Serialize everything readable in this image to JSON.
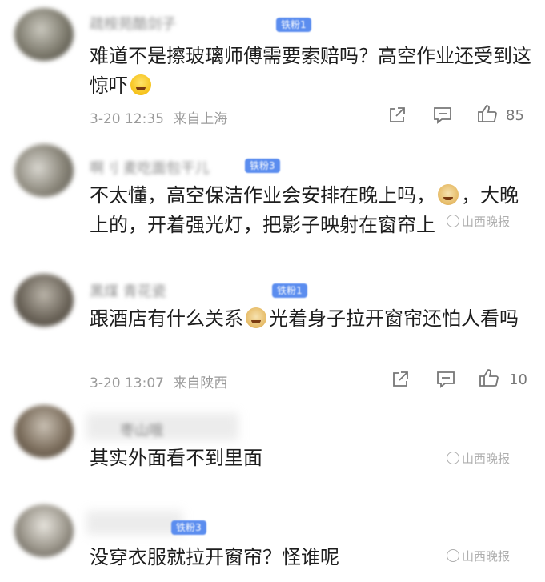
{
  "comments": [
    {
      "name": "疏桉苑酷剑子",
      "badge": "铁粉1",
      "text": "难道不是擦玻璃师傅需要索赔吗？高空作业还受到这惊吓",
      "time": "3-20 12:35",
      "location": "来自上海",
      "likes": "85",
      "emoji": "laughing-crying-emoji"
    },
    {
      "name": "啊刂 麦吃面包干儿",
      "badge": "铁粉3",
      "text_part1": "不太懂，高空保洁作业会安排在晚上吗，",
      "text_part2": "，大晚上的，开着强光灯，把影子映射在窗帘上",
      "emoji": "doge-emoji"
    },
    {
      "name": "黑煤 青花瓷",
      "badge": "铁粉1",
      "text_part1": "跟酒店有什么关系",
      "text_part2": "光着身子拉开窗帘还怕人看吗",
      "time": "3-20 13:07",
      "location": "来自陕西",
      "likes": "10",
      "emoji": "doge-emoji"
    },
    {
      "name": "枣山哦",
      "text": "其实外面看不到里面"
    },
    {
      "name": "",
      "badge": "铁粉3",
      "text": "没穿衣服就拉开窗帘？怪谁呢"
    }
  ],
  "watermark": "山西晚报",
  "icons": {
    "share": "share-icon",
    "comment": "comment-icon",
    "like": "thumbs-up-icon"
  },
  "colors": {
    "badge": "#5b8def",
    "text": "#1d1d1d",
    "meta": "#9a9a9a"
  }
}
